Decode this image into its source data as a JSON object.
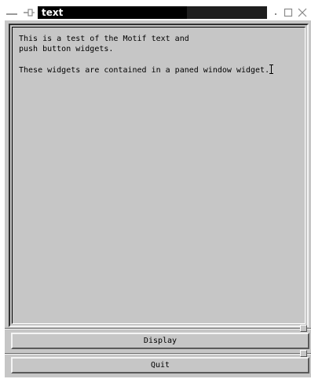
{
  "window": {
    "title": "text",
    "controls": {
      "menu_icon": "window-menu-icon",
      "pin_icon": "pin-icon",
      "minimize_icon": "minimize-icon",
      "maximize_icon": "maximize-icon",
      "close_icon": "close-icon"
    }
  },
  "text_widget": {
    "lines": [
      "This is a test of the Motif text and",
      "push button widgets.",
      "",
      "These widgets are contained in a paned window widget."
    ]
  },
  "buttons": {
    "display_label": "Display",
    "quit_label": "Quit"
  },
  "colors": {
    "background": "#c6c6c6",
    "title_active": "#000000",
    "title_text": "#ffffff"
  }
}
